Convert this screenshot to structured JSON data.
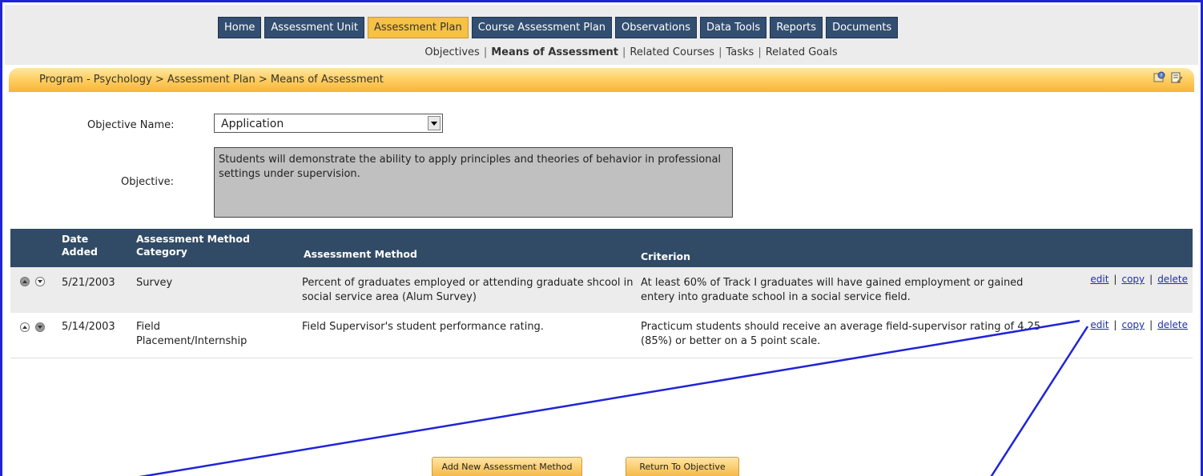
{
  "nav": {
    "tabs": [
      {
        "label": "Home",
        "active": false
      },
      {
        "label": "Assessment Unit",
        "active": false
      },
      {
        "label": "Assessment Plan",
        "active": true
      },
      {
        "label": "Course Assessment Plan",
        "active": false
      },
      {
        "label": "Observations",
        "active": false
      },
      {
        "label": "Data Tools",
        "active": false
      },
      {
        "label": "Reports",
        "active": false
      },
      {
        "label": "Documents",
        "active": false
      }
    ],
    "subnav": [
      {
        "label": "Objectives",
        "current": false
      },
      {
        "label": "Means of Assessment",
        "current": true
      },
      {
        "label": "Related Courses",
        "current": false
      },
      {
        "label": "Tasks",
        "current": false
      },
      {
        "label": "Related Goals",
        "current": false
      }
    ],
    "separator": "|"
  },
  "breadcrumb": {
    "parts": [
      "Program - Psychology",
      "Assessment Plan",
      "Means of Assessment"
    ],
    "separator": ">",
    "icons": [
      "help-icon",
      "notes-icon"
    ]
  },
  "form": {
    "objective_name_label": "Objective Name:",
    "objective_name_value": "Application",
    "objective_label": "Objective:",
    "objective_text": "Students will demonstrate the ability to apply principles and theories of behavior in professional settings under supervision."
  },
  "table": {
    "headers": {
      "date_line1": "Date",
      "date_line2": "Added",
      "category_line1": "Assessment Method",
      "category_line2": "Category",
      "method": "Assessment Method",
      "criterion": "Criterion"
    },
    "rows": [
      {
        "date": "5/21/2003",
        "category": "Survey",
        "method": "Percent of graduates employed or attending graduate shcool in social service area (Alum Survey)",
        "criterion": "At least 60% of Track I graduates will have gained employment or gained entery into graduate school in a social service field."
      },
      {
        "date": "5/14/2003",
        "category": "Field Placement/Internship",
        "method": "Field Supervisor's student performance rating.",
        "criterion": "Practicum students should receive an average field-supervisor rating of 4.25 (85%) or better on a 5 point scale."
      }
    ],
    "actions": {
      "edit": "edit",
      "copy": "copy",
      "delete": "delete",
      "separator": "|"
    }
  },
  "buttons": {
    "add": "Add New Assessment Method",
    "return": "Return To Objective"
  },
  "colors": {
    "annotation": "#1f24d6",
    "tab_bg": "#324e70",
    "tab_active": "#f5c146",
    "header_bg": "#314b66"
  }
}
